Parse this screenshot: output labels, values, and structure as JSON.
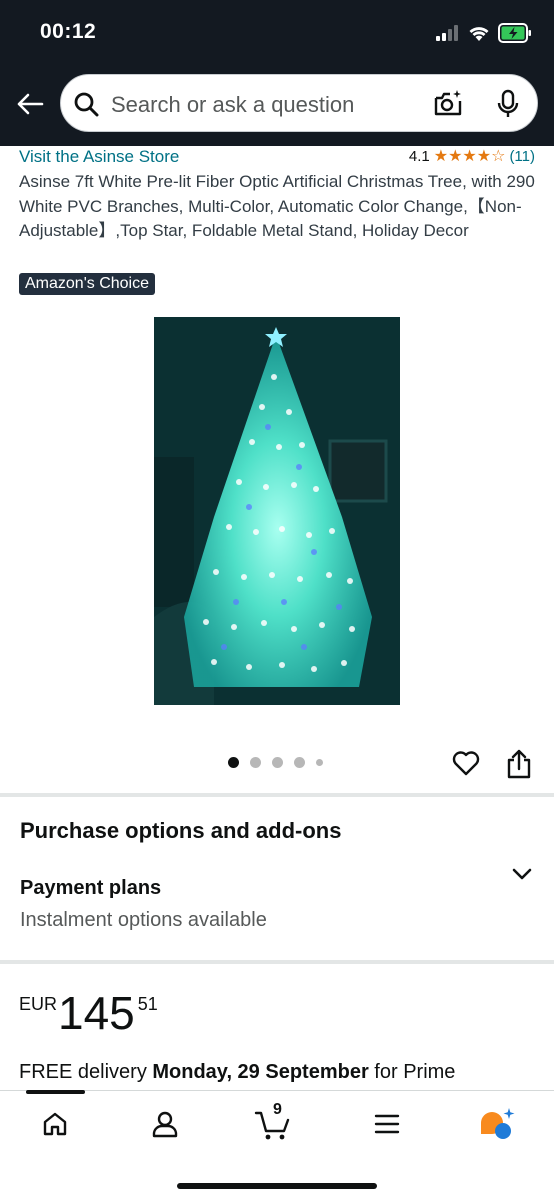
{
  "status_bar": {
    "time": "00:12"
  },
  "header": {
    "search_placeholder": "Search or ask a question",
    "icons": [
      "back-arrow-icon",
      "search-icon",
      "camera-scan-icon",
      "microphone-icon"
    ]
  },
  "product": {
    "store_link": "Visit the Asinse Store",
    "rating_value": "4.1",
    "rating_stars": 4.1,
    "rating_stars_text": "★★★★☆",
    "review_count": "(11)",
    "title": "Asinse 7ft White Pre-lit Fiber Optic Artificial Christmas Tree, with 290 White PVC Branches, Multi-Color, Automatic Color Change,【Non-Adjustable】,Top Star, Foldable Metal Stand, Holiday Decor",
    "badge": "Amazon's Choice",
    "image_count": 5,
    "active_image_index": 0
  },
  "purchase": {
    "heading": "Purchase options and add-ons",
    "payment_title": "Payment plans",
    "payment_subtitle": "Instalment options available"
  },
  "price": {
    "currency": "EUR",
    "whole": "145",
    "fraction": "51"
  },
  "delivery": {
    "prefix": "FREE delivery ",
    "date": "Monday, 29 September",
    "suffix": " for Prime"
  },
  "bottom_nav": {
    "cart_count": "9",
    "items": [
      "home-icon",
      "account-icon",
      "cart-icon",
      "menu-icon",
      "rufus-ai-icon"
    ]
  },
  "colors": {
    "header_bg": "#131921",
    "link": "#007185",
    "star": "#e47911",
    "badge_bg": "#232f3e",
    "ai_orange": "#f88a1e",
    "ai_blue": "#1f7bd8"
  }
}
